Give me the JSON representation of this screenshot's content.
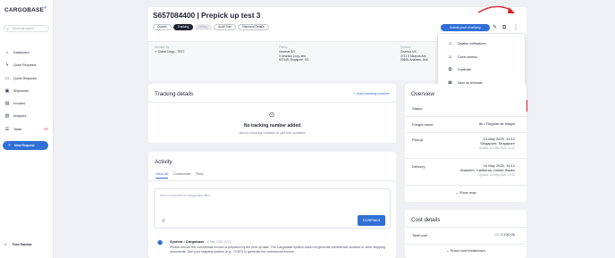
{
  "app": {
    "logo_text": "CARGOBASE",
    "logo_mark": "®"
  },
  "sidebar": {
    "search_placeholder": "Universal search",
    "items": [
      {
        "label": "Dashboard",
        "icon": "home-icon",
        "glyph": "⌂"
      },
      {
        "label": "Quick Requests",
        "icon": "lightning-icon",
        "glyph": "ϟ"
      },
      {
        "label": "Quote Requests",
        "icon": "quote-icon",
        "glyph": "▭"
      },
      {
        "label": "Shipments",
        "icon": "box-icon",
        "glyph": "▣"
      },
      {
        "label": "Invoices",
        "icon": "invoice-icon",
        "glyph": "▤"
      },
      {
        "label": "Analytics",
        "icon": "chart-icon",
        "glyph": "▥"
      },
      {
        "label": "Tasks",
        "icon": "list-icon",
        "glyph": "☰"
      }
    ],
    "new_request": "New Request",
    "fold_sidebar": "Fold Sidebar"
  },
  "header": {
    "title": "S657084400 | Prepick up test 3",
    "tabs": [
      "Quotes",
      "Tracking",
      "Billing",
      "Audit Trail",
      "Shipment Details"
    ],
    "submit_pod": "Submit proof of delivery",
    "handled_by_label": "Handled by",
    "handled_by_value": "Global Cargo - TEST",
    "pickup_label": "Pickup",
    "pickup_lines": [
      "Gearbox SG",
      "3 Gearbox Loop, test",
      "637145, Singapore, SG"
    ],
    "delivery_label": "Delivery",
    "delivery_lines": [
      "Gearbox US",
      "2721 S Miranda Ave",
      "92806, Anaheim, Unit"
    ]
  },
  "menu": {
    "items": [
      {
        "label": "Disable notifications",
        "icon": "bell-icon",
        "glyph": "🔔"
      },
      {
        "label": "Guest access",
        "icon": "user-icon",
        "glyph": "👤"
      },
      {
        "label": "Duplicate",
        "icon": "duplicate-icon",
        "glyph": "⧉"
      },
      {
        "label": "Save as template",
        "icon": "template-icon",
        "glyph": "▦"
      },
      {
        "label": "Cancel shipment",
        "icon": "cancel-icon",
        "glyph": "⊘"
      },
      {
        "label": "Cancel and book another provider",
        "icon": "cancel-rebook-icon",
        "glyph": "⊗"
      }
    ]
  },
  "tracking": {
    "title": "Tracking details",
    "add_link": "+ Add tracking number",
    "empty_title": "No tracking number added",
    "empty_sub": "Add a tracking number to get live updates"
  },
  "activity": {
    "title": "Activity",
    "tabs": [
      "View all",
      "Comments",
      "Files"
    ],
    "placeholder": "Add a comment or drag/paste files",
    "comment_button": "Comment",
    "entry_author": "System • Cargobase",
    "entry_time": "12 May 2025, 10:22",
    "entry_text": "Please ensure the commercial invoice is prepared by the pick up date. The Cargobase system does not generate commercial invoices or other shipping documents. Use your shipping system (e.g., TCRO) to generate the commercial invoice."
  },
  "overview": {
    "title": "Overview",
    "status_label": "Status",
    "freight_label": "Freight mode",
    "freight_value": "Air • Regular air freight",
    "pickup_label": "Pickup",
    "pickup_date": "14 May 2025, 10:12",
    "pickup_place": "Singapore, Singapore",
    "pickup_quoted": "Quoted: 14 May 2025, 10:12",
    "delivery_label": "Delivery",
    "delivery_date": "16 May 2025, 19:12",
    "delivery_place": "Anaheim, California, United States",
    "delivery_quoted": "Quoted: 16 May 2025, 19:12",
    "show_map": "Show map"
  },
  "cost": {
    "title": "Cost details",
    "total_label": "Total cost",
    "currency": "USD",
    "total_value": "2,130.00",
    "breakdown": "Show cost breakdown"
  }
}
